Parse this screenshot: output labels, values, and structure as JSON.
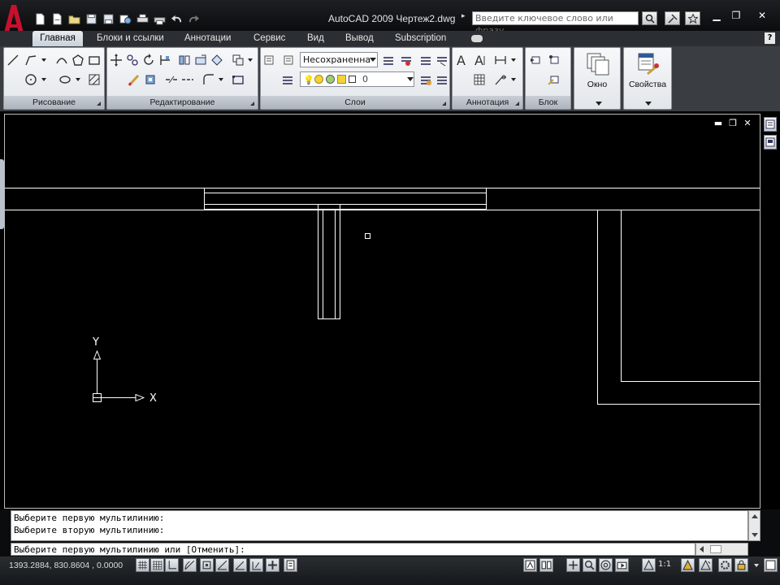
{
  "window": {
    "title": "AutoCAD 2009 Чертеж2.dwg",
    "search_placeholder": "Введите ключевое слово или фразу"
  },
  "quick_access_icons": [
    "new-icon",
    "open-icon",
    "open-folder-icon",
    "save-icon",
    "save-as-icon",
    "publish-icon",
    "plot-icon",
    "print-icon",
    "undo-icon",
    "redo-icon"
  ],
  "tabs": [
    {
      "label": "Главная",
      "active": true
    },
    {
      "label": "Блоки и ссылки"
    },
    {
      "label": "Аннотации"
    },
    {
      "label": "Сервис"
    },
    {
      "label": "Вид"
    },
    {
      "label": "Вывод"
    },
    {
      "label": "Subscription"
    }
  ],
  "help_label": "?",
  "panels": {
    "draw": "Рисование",
    "modify": "Редактирование",
    "layers": "Слои",
    "annotation": "Аннотация",
    "block": "Блок",
    "window": "Окно",
    "properties": "Свойства"
  },
  "layer_state": "Несохраненна",
  "current_layer": "0",
  "command_line": {
    "history": [
      "Выберите первую мультилинию:",
      "Выберите вторую мультилинию:"
    ],
    "prompt": "Выберите первую мультилинию или [Отменить]:"
  },
  "ucs": {
    "x_label": "X",
    "y_label": "Y"
  },
  "status": {
    "coordinates": "1393.2884, 830.8604 , 0.0000",
    "annotation_scale": "1:1"
  },
  "colors": {
    "drawing_background": "#000000",
    "geometry": "#ffffff",
    "ribbon_bg": "#e6e9ed",
    "title_bg": "#111316",
    "logo_red": "#c8102e"
  }
}
